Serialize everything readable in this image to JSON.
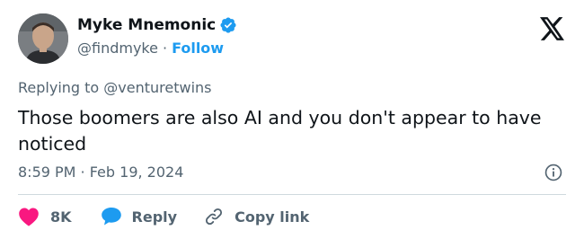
{
  "author": {
    "name": "Myke Mnemonic",
    "handle": "@findmyke",
    "separator": "·",
    "follow_label": "Follow",
    "verified_icon": "verified-badge-icon",
    "verified_color": "#1d9bf0"
  },
  "brand": {
    "logo_icon": "x-logo-icon"
  },
  "reply_context": {
    "prefix": "Replying to",
    "handle": "@venturetwins"
  },
  "tweet": {
    "text": "Those boomers are also AI and you don't appear to have noticed",
    "timestamp": "8:59 PM · Feb 19, 2024"
  },
  "actions": {
    "likes": "8K",
    "reply_label": "Reply",
    "copy_link_label": "Copy link",
    "like_icon": "heart-icon",
    "reply_icon": "speech-bubble-icon",
    "copy_icon": "link-icon",
    "info_icon": "info-icon",
    "like_color": "#f91880",
    "reply_color": "#1d9bf0"
  },
  "colors": {
    "text": "#0f1419",
    "secondary_text": "#536471",
    "accent": "#1d9bf0",
    "divider": "#cfd9de"
  }
}
